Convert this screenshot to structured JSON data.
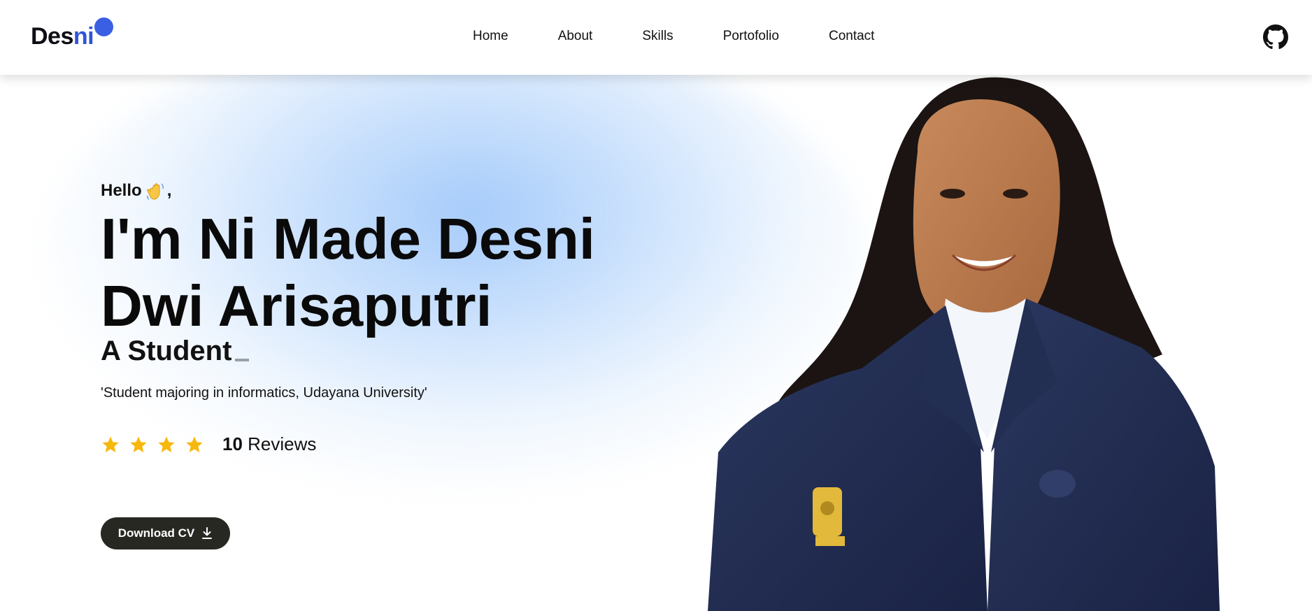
{
  "header": {
    "logo": {
      "part1": "Des",
      "part2": "ni"
    },
    "nav": [
      {
        "label": "Home"
      },
      {
        "label": "About"
      },
      {
        "label": "Skills"
      },
      {
        "label": "Portofolio"
      },
      {
        "label": "Contact"
      }
    ],
    "github_icon": "github-icon"
  },
  "hero": {
    "greeting": "Hello",
    "greeting_suffix": ",",
    "greeting_emoji": "waving-hand-icon",
    "name_line1": "I'm Ni Made Desni",
    "name_line2": "Dwi Arisaputri",
    "role": "A Student",
    "description": "'Student majoring in informatics, Udayana University'",
    "rating": {
      "stars": 4,
      "count": "10",
      "label": "Reviews"
    },
    "cv_button": "Download CV",
    "cv_icon": "download-icon"
  },
  "colors": {
    "accent": "#3b5fe3",
    "star": "#f7b80c",
    "button": "#272822",
    "jacket": "#1f2a4d"
  }
}
